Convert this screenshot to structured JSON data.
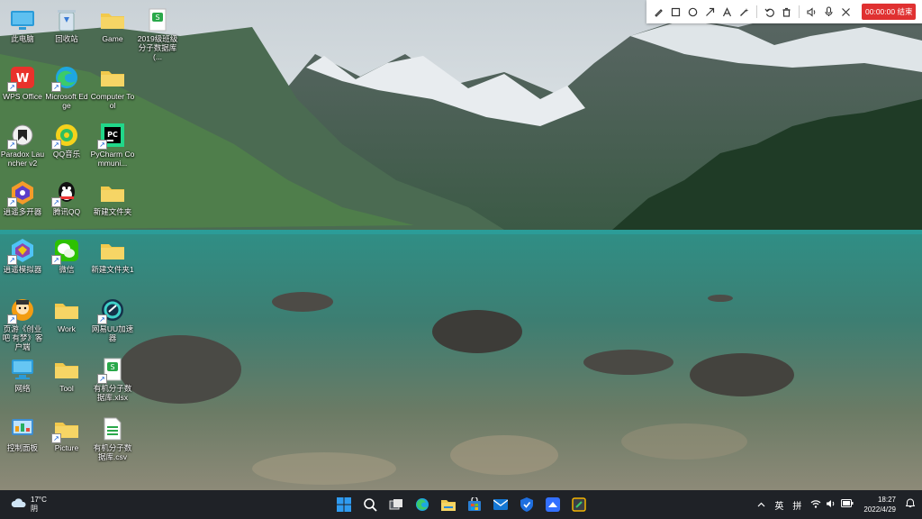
{
  "desktop": {
    "icons": [
      {
        "label": "此电脑",
        "icon": "computer-icon"
      },
      {
        "label": "回收站",
        "icon": "recycle-bin-icon"
      },
      {
        "label": "Game",
        "icon": "folder-icon"
      },
      {
        "label": "2019级班级分子数据库 (...",
        "icon": "spreadsheet-icon"
      },
      {
        "label": "WPS Office",
        "icon": "wps-icon"
      },
      {
        "label": "Microsoft Edge",
        "icon": "edge-icon"
      },
      {
        "label": "Computer Tool",
        "icon": "folder-icon"
      },
      {
        "label": "Paradox Launcher v2",
        "icon": "paradox-icon"
      },
      {
        "label": "QQ音乐",
        "icon": "qq-music-icon"
      },
      {
        "label": "PyCharm Communi...",
        "icon": "pycharm-icon"
      },
      {
        "label": "逍遥多开器",
        "icon": "xiaoyao-multi-icon"
      },
      {
        "label": "腾讯QQ",
        "icon": "qq-icon"
      },
      {
        "label": "新建文件夹",
        "icon": "folder-icon"
      },
      {
        "label": "逍遥模拟器",
        "icon": "xiaoyao-emulator-icon"
      },
      {
        "label": "微信",
        "icon": "wechat-icon"
      },
      {
        "label": "新建文件夹1",
        "icon": "folder-icon"
      },
      {
        "label": "页游《创业吧 有梦》客户端",
        "icon": "game-client-icon"
      },
      {
        "label": "Work",
        "icon": "folder-icon"
      },
      {
        "label": "网易UU加速器",
        "icon": "uu-accelerator-icon"
      },
      {
        "label": "网络",
        "icon": "network-icon"
      },
      {
        "label": "Tool",
        "icon": "folder-icon"
      },
      {
        "label": "有机分子数据库.xlsx",
        "icon": "spreadsheet-icon"
      },
      {
        "label": "控制面板",
        "icon": "control-panel-icon"
      },
      {
        "label": "Picture",
        "icon": "folder-icon"
      },
      {
        "label": "有机分子数据库.csv",
        "icon": "csv-file-icon"
      }
    ]
  },
  "toolbar": {
    "tools": [
      "pen-icon",
      "rectangle-icon",
      "ellipse-icon",
      "arrow-icon",
      "text-icon",
      "magic-wand-icon",
      "undo-icon",
      "delete-icon"
    ],
    "media": [
      "speaker-icon",
      "microphone-icon",
      "close-icon"
    ],
    "record_label": "00:00:00 结束",
    "record_color": "#e03131"
  },
  "taskbar": {
    "weather_temp": "17°C",
    "weather_desc": "阴",
    "apps": [
      "windows-start-icon",
      "search-icon",
      "task-view-icon",
      "edge-icon",
      "file-explorer-icon",
      "store-icon",
      "mail-icon",
      "security-icon",
      "feishu-icon",
      "app-icon"
    ],
    "ime_lang": "英",
    "ime_mode": "拼",
    "time": "18:27",
    "date": "2022/4/29"
  }
}
